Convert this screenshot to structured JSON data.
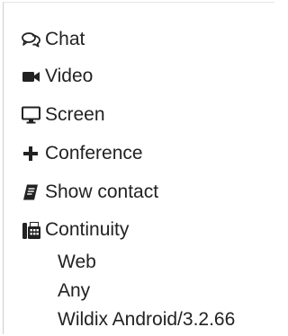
{
  "menu": {
    "items": [
      {
        "label": "Chat",
        "icon": "chat-bubbles-icon"
      },
      {
        "label": "Video",
        "icon": "video-camera-icon"
      },
      {
        "label": "Screen",
        "icon": "monitor-icon"
      },
      {
        "label": "Conference",
        "icon": "plus-icon"
      },
      {
        "label": "Show contact",
        "icon": "address-book-icon"
      },
      {
        "label": "Continuity",
        "icon": "fax-phone-icon"
      }
    ],
    "continuity_details": [
      "Web",
      "Any",
      "Wildix Android/3.2.66"
    ]
  }
}
